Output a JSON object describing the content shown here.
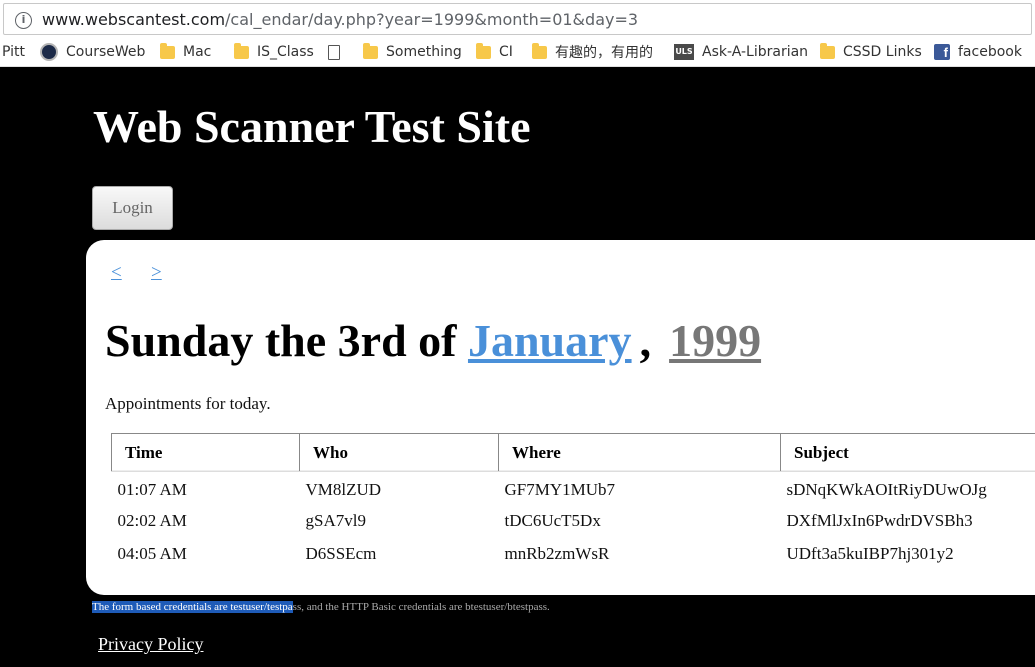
{
  "browser": {
    "url_domain": "www.webscantest.com",
    "url_path": "/cal_endar/day.php?year=1999&month=01&day=3",
    "bookmarks": [
      {
        "label": "Pitt",
        "icon": "none"
      },
      {
        "label": "CourseWeb",
        "icon": "pitt-seal-icon"
      },
      {
        "label": "Mac",
        "icon": "folder-icon"
      },
      {
        "label": "IS_Class",
        "icon": "folder-icon"
      },
      {
        "label": "",
        "icon": "page-icon"
      },
      {
        "label": "Something",
        "icon": "folder-icon"
      },
      {
        "label": "CI",
        "icon": "folder-icon"
      },
      {
        "label": "有趣的，有用的",
        "icon": "folder-icon"
      },
      {
        "label": "Ask-A-Librarian",
        "icon": "uls-icon"
      },
      {
        "label": "CSSD Links",
        "icon": "folder-icon"
      },
      {
        "label": "facebook",
        "icon": "facebook-icon"
      }
    ],
    "uls_badge": "ULS",
    "fb_glyph": "f"
  },
  "site": {
    "title": "Web Scanner Test Site",
    "login_label": "Login"
  },
  "calendar": {
    "prev": "<",
    "next": ">",
    "heading_prefix": "Sunday the 3rd of ",
    "month": "January",
    "separator": ",",
    "year": "1999",
    "caption": "Appointments for today.",
    "columns": [
      "Time",
      "Who",
      "Where",
      "Subject"
    ],
    "rows": [
      [
        "01:07 AM",
        "VM8lZUD",
        "GF7MY1MUb7",
        "sDNqKWkAOItRiyDUwOJg"
      ],
      [
        "02:02 AM",
        "gSA7vl9",
        "tDC6UcT5Dx",
        "DXfMlJxIn6PwdrDVSBh3"
      ],
      [
        "04:05 AM",
        "D6SSEcm",
        "mnRb2zmWsR",
        "UDft3a5kuIBP7hj301y2"
      ]
    ]
  },
  "footer": {
    "note_selected": "The form based credentials are testuser/testpa",
    "note_rest": "ss, and the HTTP Basic credentials are btestuser/btestpass.",
    "privacy": "Privacy Policy"
  },
  "colors": {
    "link_blue": "#4a90d9",
    "year_gray": "#777777",
    "selection": "#1e5bb8"
  }
}
